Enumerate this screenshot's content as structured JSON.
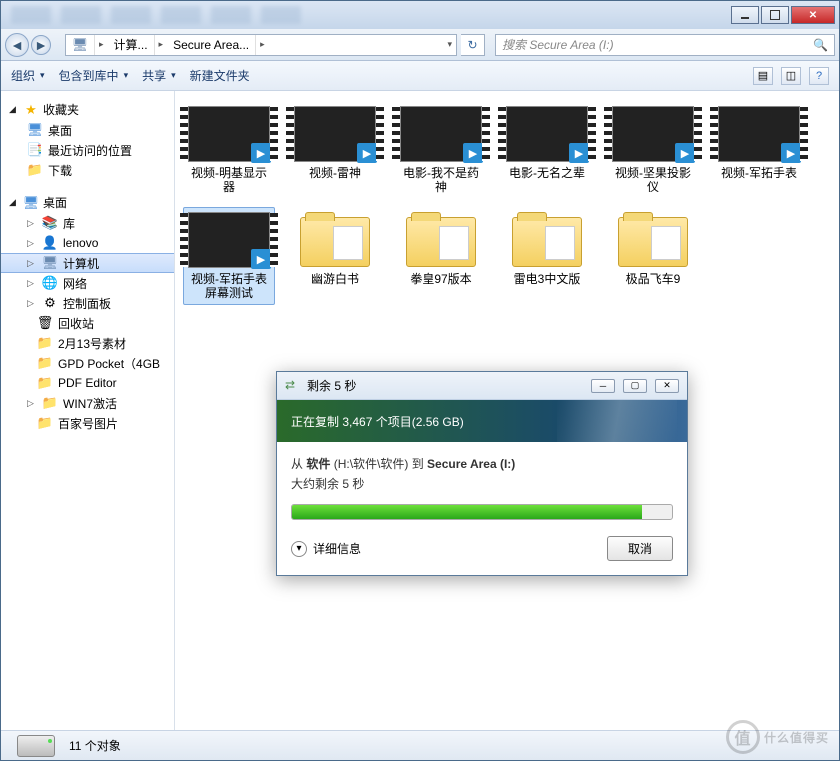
{
  "breadcrumb": {
    "computer": "计算...",
    "drive": "Secure Area...",
    "sep": "▸"
  },
  "search": {
    "placeholder": "搜索 Secure Area (I:)"
  },
  "toolbar": {
    "organize": "组织",
    "include": "包含到库中",
    "share": "共享",
    "newfolder": "新建文件夹"
  },
  "sidebar": {
    "favorites": "收藏夹",
    "fav_items": {
      "desktop": "桌面",
      "recent": "最近访问的位置",
      "downloads": "下载"
    },
    "desktop": "桌面",
    "desk_items": {
      "library": "库",
      "lenovo": "lenovo",
      "computer": "计算机",
      "network": "网络",
      "control": "控制面板",
      "recycle": "回收站",
      "feb13": "2月13号素材",
      "gpd": "GPD Pocket（4GB",
      "pdf": "PDF Editor",
      "win7": "WIN7激活",
      "baijia": "百家号图片"
    }
  },
  "items": [
    {
      "label": "视频-明基显示器",
      "type": "video"
    },
    {
      "label": "视频-雷神",
      "type": "video"
    },
    {
      "label": "电影-我不是药神",
      "type": "video"
    },
    {
      "label": "电影-无名之辈",
      "type": "video"
    },
    {
      "label": "视频-坚果投影仪",
      "type": "video"
    },
    {
      "label": "视频-军拓手表",
      "type": "video"
    },
    {
      "label": "视频-军拓手表屏幕测试",
      "type": "video",
      "selected": true
    },
    {
      "label": "幽游白书",
      "type": "folder"
    },
    {
      "label": "拳皇97版本",
      "type": "folder"
    },
    {
      "label": "雷电3中文版",
      "type": "folder"
    },
    {
      "label": "极品飞车9",
      "type": "folder"
    }
  ],
  "status": {
    "count": "11 个对象"
  },
  "dialog": {
    "title": "剩余 5 秒",
    "header": "正在复制 3,467 个项目(2.56 GB)",
    "from_prefix": "从 ",
    "from_bold": "软件",
    "from_path": " (H:\\软件\\软件) 到 ",
    "to_bold": "Secure Area (I:)",
    "eta": "大约剩余 5 秒",
    "details": "详细信息",
    "cancel": "取消"
  },
  "watermark": "什么值得买"
}
